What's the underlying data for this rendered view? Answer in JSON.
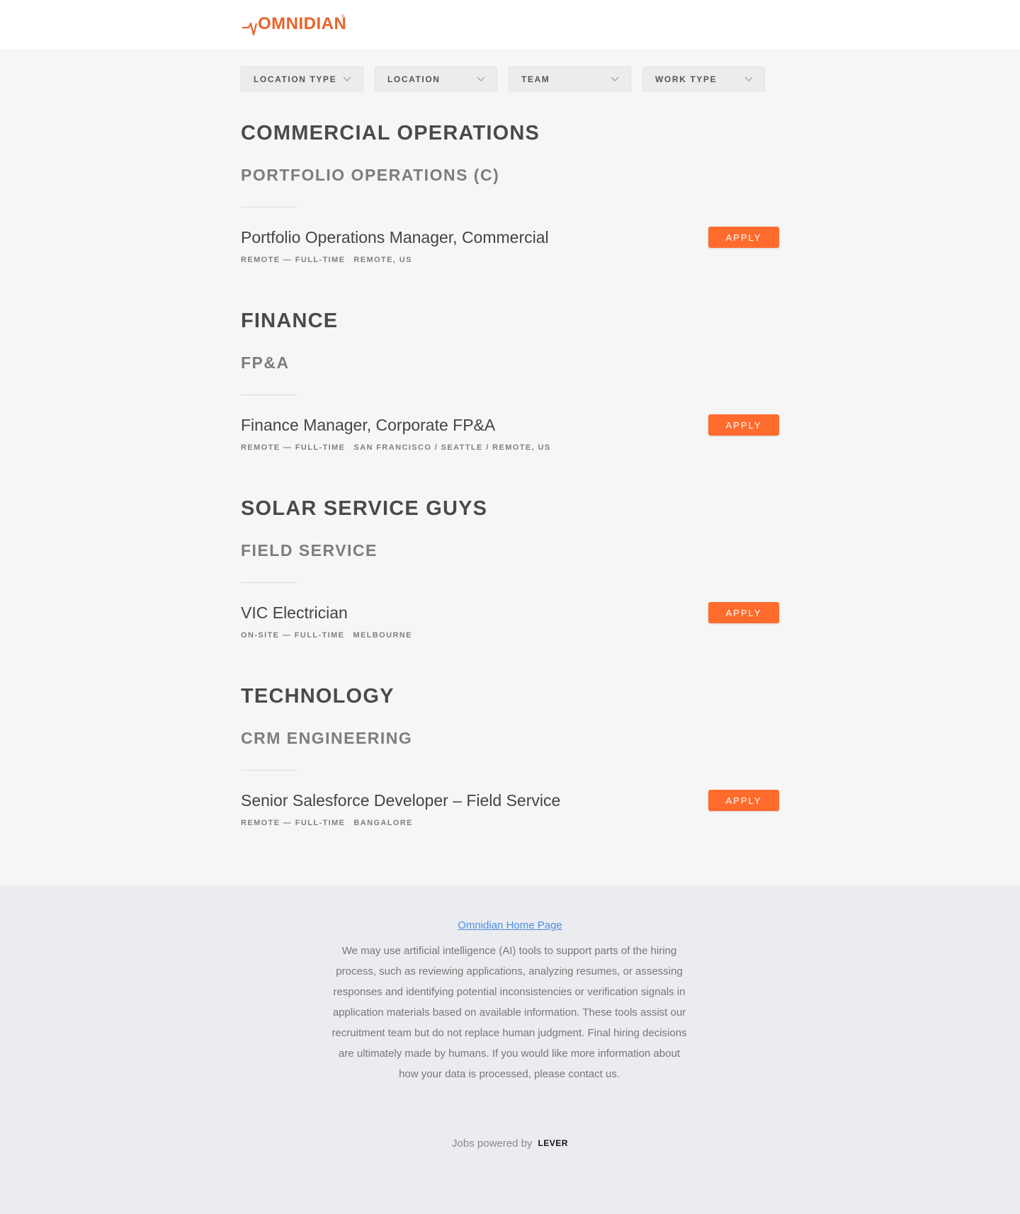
{
  "header": {
    "logo_text": "OMNIDIAN",
    "brand_color": "#e8632b"
  },
  "filters": [
    {
      "label": "LOCATION TYPE"
    },
    {
      "label": "LOCATION"
    },
    {
      "label": "TEAM"
    },
    {
      "label": "WORK TYPE"
    }
  ],
  "departments": [
    {
      "title": "COMMERCIAL OPERATIONS",
      "team": "PORTFOLIO OPERATIONS (C)",
      "job": {
        "title": "Portfolio Operations Manager, Commercial",
        "work_type": "REMOTE — FULL-TIME",
        "location": "REMOTE, US",
        "apply_label": "APPLY"
      }
    },
    {
      "title": "FINANCE",
      "team": "FP&A",
      "job": {
        "title": "Finance Manager, Corporate FP&A",
        "work_type": "REMOTE — FULL-TIME",
        "location": "SAN FRANCISCO / SEATTLE / REMOTE, US",
        "apply_label": "APPLY"
      }
    },
    {
      "title": "SOLAR SERVICE GUYS",
      "team": "FIELD SERVICE",
      "job": {
        "title": "VIC Electrician",
        "work_type": "ON-SITE — FULL-TIME",
        "location": "MELBOURNE",
        "apply_label": "APPLY"
      }
    },
    {
      "title": "TECHNOLOGY",
      "team": "CRM ENGINEERING",
      "job": {
        "title": "Senior Salesforce Developer – Field Service",
        "work_type": "REMOTE — FULL-TIME",
        "location": "BANGALORE",
        "apply_label": "APPLY"
      }
    }
  ],
  "footer": {
    "home_link": "Omnidian Home Page",
    "disclaimer": "We may use artificial intelligence (AI) tools to support parts of the hiring process, such as reviewing applications, analyzing resumes, or assessing responses and identifying potential inconsistencies or verification signals in application materials based on available information. These tools assist our recruitment team but do not replace human judgment. Final hiring decisions are ultimately made by humans. If you would like more information about how your data is processed, please contact us.",
    "powered_by": "Jobs powered by",
    "powered_brand": "LEVER"
  },
  "colors": {
    "apply_button": "#ff6b2d",
    "link": "#4a90e2"
  },
  "icons": {
    "logo": "omnidian-logo",
    "filter": "chevron-down-icon"
  }
}
